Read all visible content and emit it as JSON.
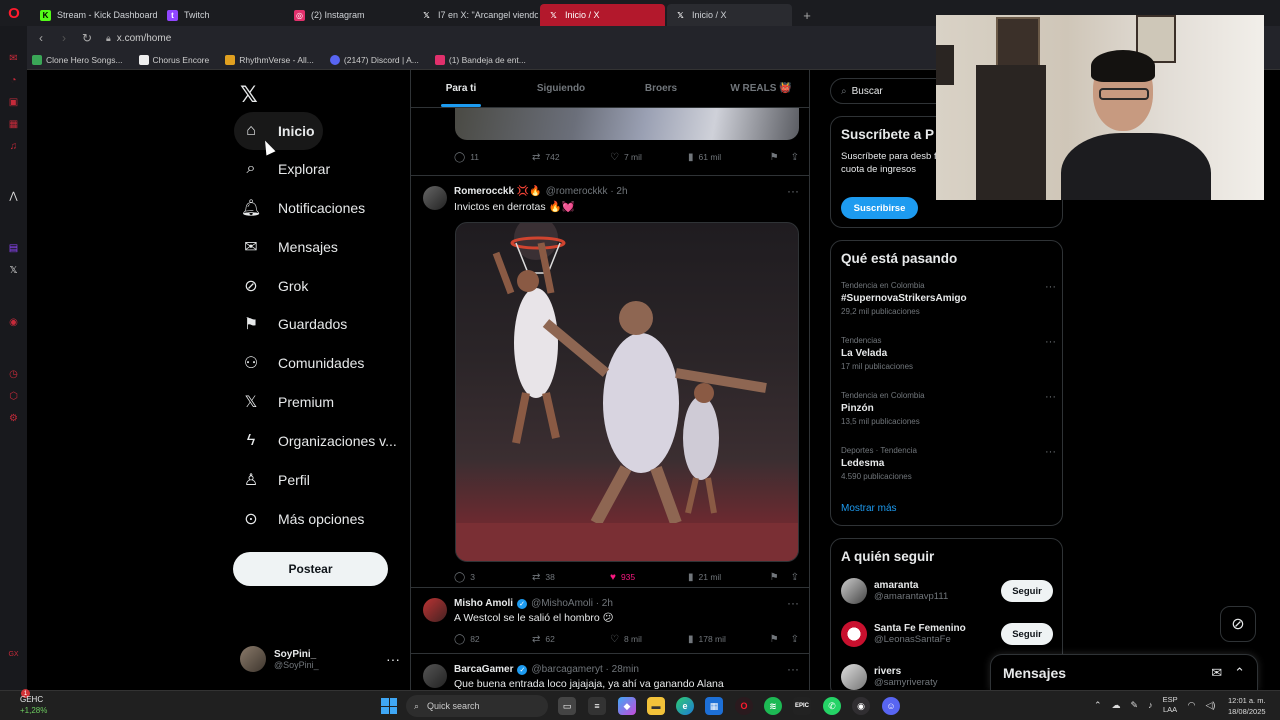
{
  "browser": {
    "tabs": [
      {
        "label": "Stream - Kick Dashboard",
        "color": "#53fc18",
        "glyph": "K"
      },
      {
        "label": "Twitch",
        "color": "#9146ff",
        "glyph": "t"
      },
      {
        "label": "(2) Instagram",
        "color": "#e1306c",
        "glyph": "◎"
      },
      {
        "label": "I7 en X: \"Arcangel viendo",
        "color": "#000000",
        "glyph": "𝕏"
      },
      {
        "label": "Inicio / X",
        "color": "#000000",
        "glyph": "𝕏"
      },
      {
        "label": "Inicio / X",
        "color": "#000000",
        "glyph": "𝕏"
      }
    ],
    "url": "x.com/home",
    "bookmarks": [
      {
        "label": "Clone Hero Songs...",
        "color": "#3aa757"
      },
      {
        "label": "Chorus Encore",
        "color": "#eeeeee"
      },
      {
        "label": "RhythmVerse - All...",
        "color": "#e0a020"
      },
      {
        "label": "(2147) Discord | A...",
        "color": "#5865f2"
      },
      {
        "label": "(1) Bandeja de ent...",
        "color": "#e1306c"
      }
    ]
  },
  "nav": {
    "items": [
      {
        "label": "Inicio",
        "icon": "home-icon"
      },
      {
        "label": "Explorar",
        "icon": "search-icon"
      },
      {
        "label": "Notificaciones",
        "icon": "bell-icon"
      },
      {
        "label": "Mensajes",
        "icon": "envelope-icon"
      },
      {
        "label": "Grok",
        "icon": "grok-icon"
      },
      {
        "label": "Guardados",
        "icon": "bookmark-icon"
      },
      {
        "label": "Comunidades",
        "icon": "people-icon"
      },
      {
        "label": "Premium",
        "icon": "x-logo-icon"
      },
      {
        "label": "Organizaciones v...",
        "icon": "lightning-icon"
      },
      {
        "label": "Perfil",
        "icon": "person-icon"
      },
      {
        "label": "Más opciones",
        "icon": "more-circle-icon"
      }
    ],
    "post_label": "Postear",
    "profile": {
      "name": "SoyPini_",
      "handle": "@SoyPini_"
    }
  },
  "timeline": {
    "tabs": [
      "Para ti",
      "Siguiendo",
      "Broers",
      "W REALS 👹"
    ],
    "tweets": [
      {
        "stats": {
          "replies": "11",
          "retweets": "742",
          "likes": "7 mil",
          "views": "61 mil"
        }
      },
      {
        "name": "Romerocckk 💢🔥",
        "handle": "@romerockkk · 2h",
        "text": "Invictos en derrotas 🔥💓",
        "stats": {
          "replies": "3",
          "retweets": "38",
          "likes": "935",
          "views": "21 mil"
        }
      },
      {
        "name": "Misho Amoli",
        "handle": "@MishoAmoli · 2h",
        "text": "A Westcol se le salió el hombro 😕",
        "stats": {
          "replies": "82",
          "retweets": "62",
          "likes": "8 mil",
          "views": "178 mil"
        }
      },
      {
        "name": "BarcaGamer",
        "handle": "@barcagameryt · 28min",
        "text": "Que buena entrada loco jajajaja, ya ahí va ganando Alana"
      }
    ]
  },
  "right": {
    "search_placeholder": "Buscar",
    "subscribe": {
      "title": "Suscríbete a P",
      "text": "Suscríbete para desb funciones y, si eres e de cuota de ingresos",
      "button": "Suscribirse"
    },
    "trends": {
      "title": "Qué está pasando",
      "items": [
        {
          "context": "Tendencia en Colombia",
          "title": "#SupernovaStrikersAmigo",
          "count": "29,2 mil publicaciones"
        },
        {
          "context": "Tendencias",
          "title": "La Velada",
          "count": "17 mil publicaciones"
        },
        {
          "context": "Tendencia en Colombia",
          "title": "Pinzón",
          "count": "13,5 mil publicaciones"
        },
        {
          "context": "Deportes · Tendencia",
          "title": "Ledesma",
          "count": "4.590 publicaciones"
        }
      ],
      "show_more": "Mostrar más"
    },
    "follow": {
      "title": "A quién seguir",
      "users": [
        {
          "name": "amaranta",
          "handle": "@amarantavp111",
          "button": "Seguir"
        },
        {
          "name": "Santa Fe Femenino",
          "handle": "@LeonasSantaFe",
          "button": "Seguir"
        },
        {
          "name": "rivers",
          "handle": "@samyriveraty",
          "button": ""
        }
      ]
    },
    "messages_title": "Mensajes"
  },
  "taskbar": {
    "stock_name": "GEHC",
    "stock_change": "+1,28%",
    "badge": "1",
    "search_placeholder": "Quick search",
    "lang1": "ESP",
    "lang2": "LAA",
    "time": "12:01 a. m.",
    "date": "18/08/2025"
  }
}
